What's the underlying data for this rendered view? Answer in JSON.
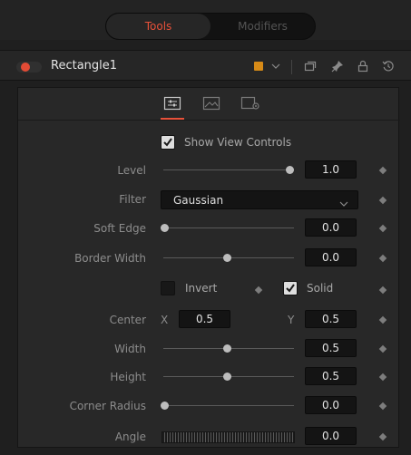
{
  "top_tabs": {
    "tools": "Tools",
    "modifiers": "Modifiers"
  },
  "header": {
    "title": "Rectangle1",
    "color_swatch": "#d68a17"
  },
  "icons": {
    "header": [
      "color-chevron-icon",
      "versions-icon",
      "pin-icon",
      "lock-icon",
      "reset-icon"
    ],
    "tabs": [
      "controls-tab-icon",
      "image-tab-icon",
      "settings-tab-icon"
    ]
  },
  "colors": {
    "accent": "#e8513a",
    "toggle_dot": "#e34b35"
  },
  "controls": {
    "show_view_controls": {
      "label": "Show View Controls",
      "checked": true
    },
    "level": {
      "label": "Level",
      "value": "1.0",
      "slider_fraction": 1.0
    },
    "filter": {
      "label": "Filter",
      "value": "Gaussian"
    },
    "soft_edge": {
      "label": "Soft Edge",
      "value": "0.0",
      "slider_fraction": 0.0
    },
    "border_width": {
      "label": "Border Width",
      "value": "0.0",
      "slider_fraction": 0.5
    },
    "invert": {
      "label": "Invert",
      "checked": false
    },
    "solid": {
      "label": "Solid",
      "checked": true
    },
    "center": {
      "label": "Center",
      "x_label": "X",
      "x_value": "0.5",
      "y_label": "Y",
      "y_value": "0.5"
    },
    "width": {
      "label": "Width",
      "value": "0.5",
      "slider_fraction": 0.5
    },
    "height": {
      "label": "Height",
      "value": "0.5",
      "slider_fraction": 0.5
    },
    "corner_radius": {
      "label": "Corner Radius",
      "value": "0.0",
      "slider_fraction": 0.0
    },
    "angle": {
      "label": "Angle",
      "value": "0.0"
    }
  }
}
